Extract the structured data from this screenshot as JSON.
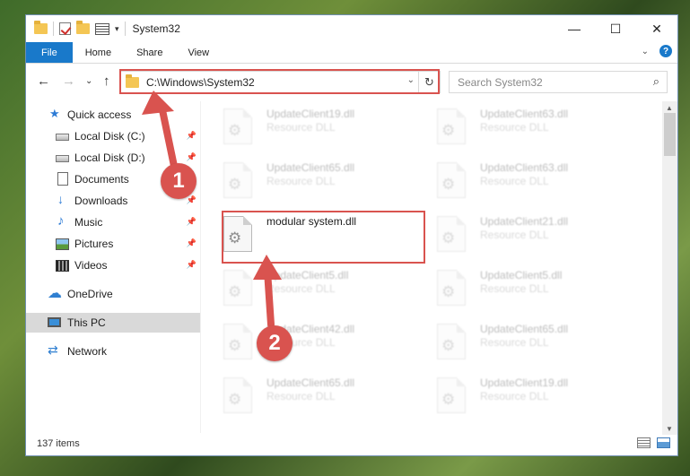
{
  "window": {
    "title": "System32",
    "controls": {
      "minimize": "—",
      "maximize": "☐",
      "close": "✕"
    }
  },
  "ribbon": {
    "tabs": [
      "File",
      "Home",
      "Share",
      "View"
    ],
    "collapse_glyph": "⌄",
    "help_glyph": "?"
  },
  "navigation": {
    "back": "←",
    "forward": "→",
    "recent": "⌄",
    "up": "↑",
    "address": "C:\\Windows\\System32",
    "address_dropdown": "⌄",
    "refresh": "↻",
    "search_placeholder": "Search System32",
    "search_glyph": "⌕"
  },
  "sidebar": {
    "items": [
      {
        "label": "Quick access",
        "icon": "star-icon",
        "glyph": "★"
      },
      {
        "label": "Local Disk (C:)",
        "icon": "disk-icon",
        "pinned": true
      },
      {
        "label": "Local Disk (D:)",
        "icon": "disk-icon",
        "pinned": true
      },
      {
        "label": "Documents",
        "icon": "document-icon",
        "pinned": true
      },
      {
        "label": "Downloads",
        "icon": "download-icon",
        "glyph": "↓",
        "pinned": true
      },
      {
        "label": "Music",
        "icon": "music-icon",
        "glyph": "♪",
        "pinned": true
      },
      {
        "label": "Pictures",
        "icon": "picture-icon",
        "pinned": true
      },
      {
        "label": "Videos",
        "icon": "video-icon",
        "pinned": true
      },
      {
        "label": "OneDrive",
        "icon": "cloud-icon",
        "glyph": "☁"
      },
      {
        "label": "This PC",
        "icon": "computer-icon",
        "selected": true
      },
      {
        "label": "Network",
        "icon": "network-icon",
        "glyph": "⇄"
      }
    ],
    "pin_glyph": "📌"
  },
  "files": {
    "type_label": "Resource DLL",
    "gear_glyph": "⚙",
    "items": [
      {
        "name": "UpdateClient19.dll",
        "type": "Resource DLL"
      },
      {
        "name": "UpdateClient63.dll",
        "type": "Resource DLL"
      },
      {
        "name": "UpdateClient65.dll",
        "type": "Resource DLL"
      },
      {
        "name": "UpdateClient63.dll",
        "type": "Resource DLL"
      },
      {
        "name": "modular system.dll",
        "type": ""
      },
      {
        "name": "UpdateClient21.dll",
        "type": "Resource DLL"
      },
      {
        "name": "UpdateClient5.dll",
        "type": "Resource DLL"
      },
      {
        "name": "UpdateClient5.dll",
        "type": "Resource DLL"
      },
      {
        "name": "UpdateClient42.dll",
        "type": "Resource DLL"
      },
      {
        "name": "UpdateClient65.dll",
        "type": "Resource DLL"
      },
      {
        "name": "UpdateClient65.dll",
        "type": "Resource DLL"
      },
      {
        "name": "UpdateClient19.dll",
        "type": "Resource DLL"
      }
    ]
  },
  "scrollbar": {
    "up": "▲",
    "down": "▼"
  },
  "status": {
    "item_count": "137 items"
  },
  "callouts": {
    "one": "1",
    "two": "2"
  },
  "colors": {
    "accent": "#1979ca",
    "highlight": "#d9534f"
  }
}
